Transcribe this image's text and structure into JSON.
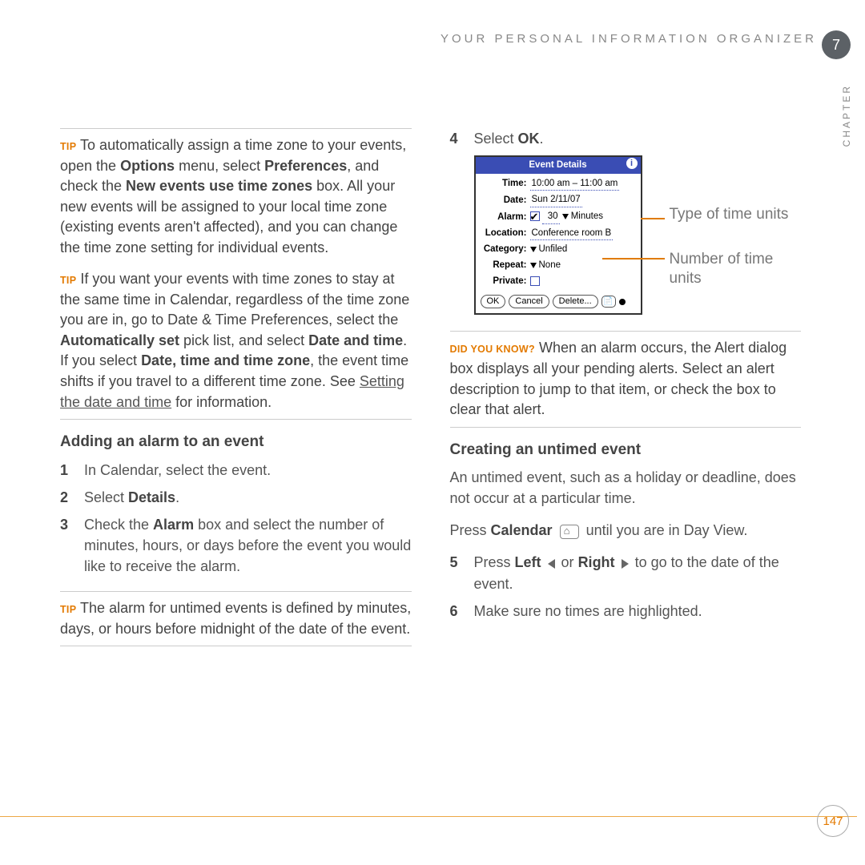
{
  "header": {
    "running_head": "YOUR PERSONAL INFORMATION ORGANIZER",
    "chapter_number": "7",
    "chapter_label": "CHAPTER"
  },
  "left": {
    "tip1": {
      "label": "TIP",
      "text_a": "To automatically assign a time zone to your events, open the ",
      "b1": "Options",
      "text_b": " menu, select ",
      "b2": "Preferences",
      "text_c": ", and check the ",
      "b3": "New events use time zones",
      "text_d": " box. All your new events will be assigned to your local time zone (existing events aren't affected), and you can change the time zone setting for individual events."
    },
    "tip2": {
      "label": "TIP",
      "text_a": "If you want your events with time zones to stay at the same time in Calendar, regardless of the time zone you are in, go to Date & Time Preferences, select the ",
      "b1": "Automatically set",
      "text_b": " pick list, and select ",
      "b2": "Date and time",
      "text_c": ". If you select ",
      "b3": "Date, time and time zone",
      "text_d": ", the event time shifts if you travel to a different time zone. See ",
      "link": "Setting the date and time",
      "text_e": " for information."
    },
    "heading": "Adding an alarm to an event",
    "steps": {
      "s1_num": "1",
      "s1": "In Calendar, select the event.",
      "s2_num": "2",
      "s2_a": "Select ",
      "s2_b": "Details",
      "s2_c": ".",
      "s3_num": "3",
      "s3_a": "Check the ",
      "s3_b": "Alarm",
      "s3_c": " box and select the number of minutes, hours, or days before the event you would like to receive the alarm."
    },
    "tip3": {
      "label": "TIP",
      "text": "The alarm for untimed events is defined by minutes, days, or hours before midnight of the date of the event."
    }
  },
  "right": {
    "step4_num": "4",
    "step4_a": "Select ",
    "step4_b": "OK",
    "step4_c": ".",
    "shot": {
      "title": "Event Details",
      "time_label": "Time:",
      "time_value": "10:00 am – 11:00 am",
      "date_label": "Date:",
      "date_value": "Sun 2/11/07",
      "alarm_label": "Alarm:",
      "alarm_value": "30",
      "alarm_units": "Minutes",
      "location_label": "Location:",
      "location_value": "Conference room B",
      "category_label": "Category:",
      "category_value": "Unfiled",
      "repeat_label": "Repeat:",
      "repeat_value": "None",
      "private_label": "Private:",
      "btn_ok": "OK",
      "btn_cancel": "Cancel",
      "btn_delete": "Delete..."
    },
    "callouts": {
      "type": "Type of time units",
      "number": "Number of time units"
    },
    "dyk": {
      "label": "DID YOU KNOW?",
      "text": "When an alarm occurs, the Alert dialog box displays all your pending alerts. Select an alert description to jump to that item, or check the box to clear that alert."
    },
    "heading2": "Creating an untimed event",
    "para1": "An untimed event, such as a holiday or deadline, does not occur at a particular time.",
    "para2_a": "Press ",
    "para2_b": "Calendar",
    "para2_c": " until you are in Day View.",
    "steps": {
      "s5_num": "5",
      "s5_a": "Press ",
      "s5_b": "Left",
      "s5_c": " or ",
      "s5_d": "Right",
      "s5_e": " to go to the date of the event.",
      "s6_num": "6",
      "s6": "Make sure no times are highlighted."
    }
  },
  "page_number": "147"
}
